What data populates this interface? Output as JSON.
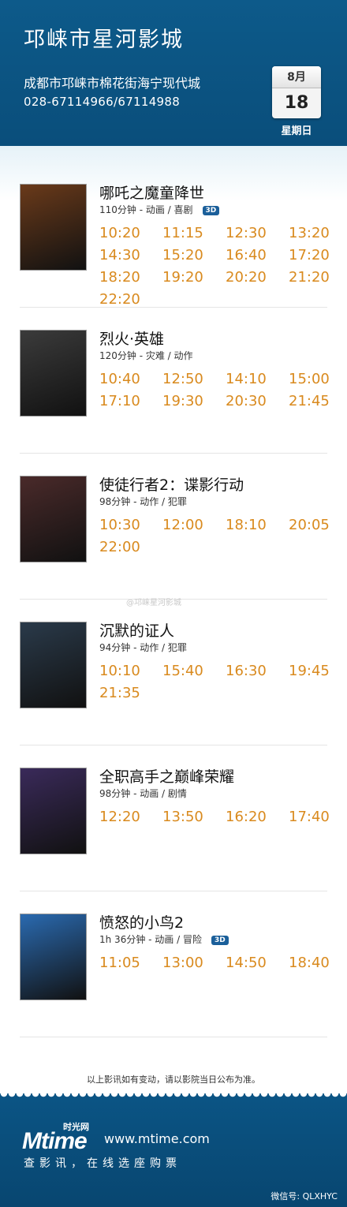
{
  "header": {
    "cinema_name": "邛崃市星河影城",
    "address": "成都市邛崃市棉花街海宁现代城",
    "phone": "028-67114966/67114988",
    "calendar": {
      "month": "8月",
      "day": "18",
      "weekday": "星期日"
    }
  },
  "movies": [
    {
      "title": "哪吒之魔童降世",
      "meta": "110分钟 - 动画 / 喜剧",
      "badge": "3D",
      "poster_color": "#6a3a1a",
      "times": [
        "10:20",
        "11:15",
        "12:30",
        "13:20",
        "14:30",
        "15:20",
        "16:40",
        "17:20",
        "18:20",
        "19:20",
        "20:20",
        "21:20",
        "22:20"
      ]
    },
    {
      "title": "烈火·英雄",
      "meta": "120分钟 - 灾难 / 动作",
      "badge": "",
      "poster_color": "#3b3b3b",
      "times": [
        "10:40",
        "12:50",
        "14:10",
        "15:00",
        "17:10",
        "19:30",
        "20:30",
        "21:45"
      ]
    },
    {
      "title": "使徒行者2：谍影行动",
      "meta": "98分钟 - 动作 / 犯罪",
      "badge": "",
      "poster_color": "#4a2a2a",
      "times": [
        "10:30",
        "12:00",
        "18:10",
        "20:05",
        "22:00"
      ]
    },
    {
      "title": "沉默的证人",
      "meta": "94分钟 - 动作 / 犯罪",
      "badge": "",
      "poster_color": "#2a3a4a",
      "times": [
        "10:10",
        "15:40",
        "16:30",
        "19:45",
        "21:35"
      ]
    },
    {
      "title": "全职高手之巅峰荣耀",
      "meta": "98分钟 - 动画 / 剧情",
      "badge": "",
      "poster_color": "#3a2a5a",
      "times": [
        "12:20",
        "13:50",
        "16:20",
        "17:40"
      ]
    },
    {
      "title": "愤怒的小鸟2",
      "meta": "1h 36分钟 - 动画 / 冒险",
      "badge": "3D",
      "poster_color": "#2a6ab0",
      "times": [
        "11:05",
        "13:00",
        "14:50",
        "18:40"
      ]
    }
  ],
  "notice": "以上影讯如有变动，请以影院当日公布为准。",
  "footer": {
    "logo": "Mtime",
    "logo_cn": "时光网",
    "url": "www.mtime.com",
    "slogan": "查影讯，在线选座购票",
    "wechat": "微信号: QLXHYC"
  },
  "watermark": "@邛崃星河影城",
  "colors": {
    "header_bg": "#0d5a8a",
    "time_color": "#d98a1e",
    "badge_bg": "#1b5f9a"
  }
}
